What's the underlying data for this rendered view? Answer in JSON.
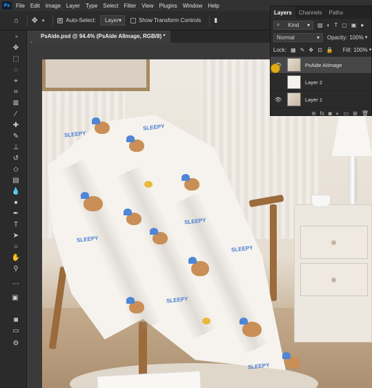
{
  "menubar": {
    "app_icon": "Ps",
    "items": [
      "File",
      "Edit",
      "Image",
      "Layer",
      "Type",
      "Select",
      "Filter",
      "View",
      "Plugins",
      "Window",
      "Help"
    ]
  },
  "options": {
    "auto_select_label": "Auto-Select:",
    "auto_select_target": "Layer",
    "show_transform_label": "Show Transform Controls"
  },
  "document_tab": {
    "title": "PsAide.psd @ 94.4% (PsAide AIImage, RGB/8) *"
  },
  "layers_panel": {
    "tabs": [
      "Layers",
      "Channels",
      "Paths"
    ],
    "filter_label": "Kind",
    "blend_mode": "Normal",
    "opacity_label": "Opacity:",
    "opacity_value": "100%",
    "lock_label": "Lock:",
    "fill_label": "Fill:",
    "fill_value": "100%",
    "layers": [
      {
        "name": "PsAide AIImage",
        "visible": true,
        "selected": true
      },
      {
        "name": "Layer 2",
        "visible": false,
        "selected": false
      },
      {
        "name": "Layer 1",
        "visible": true,
        "selected": false
      }
    ]
  },
  "canvas_text": {
    "pattern_word": "SLEEPY"
  },
  "colors": {
    "accent": "#1f5a8e",
    "panel_bg": "#2b2b2b",
    "menu_bg": "#323232",
    "bear_hat": "#4f86d6",
    "bear_body": "#c98f56",
    "dot": "#e8b93c"
  }
}
